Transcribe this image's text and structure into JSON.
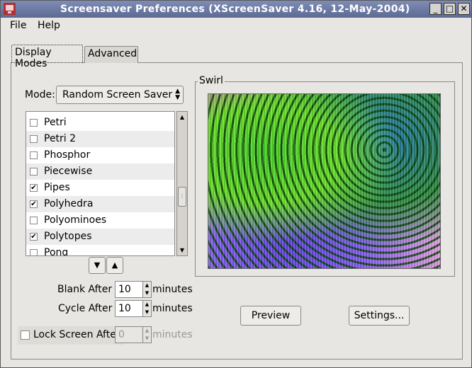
{
  "window": {
    "title": "Screensaver Preferences  (XScreenSaver 4.16, 12-May-2004)",
    "controls": {
      "minimize": "_",
      "maximize": "□",
      "close": "✕"
    }
  },
  "menubar": {
    "file": "File",
    "help": "Help"
  },
  "tabs": [
    {
      "label": "Display Modes",
      "active": true
    },
    {
      "label": "Advanced",
      "active": false
    }
  ],
  "mode": {
    "label": "Mode:",
    "value": "Random Screen Saver"
  },
  "savers": [
    {
      "label": "Petri",
      "checked": false
    },
    {
      "label": "Petri 2",
      "checked": false
    },
    {
      "label": "Phosphor",
      "checked": false
    },
    {
      "label": "Piecewise",
      "checked": false
    },
    {
      "label": "Pipes",
      "checked": true
    },
    {
      "label": "Polyhedra",
      "checked": true
    },
    {
      "label": "Polyominoes",
      "checked": false
    },
    {
      "label": "Polytopes",
      "checked": true
    },
    {
      "label": "Pong",
      "checked": false
    }
  ],
  "preview": {
    "frame_label": "Swirl",
    "preview_button": "Preview",
    "settings_button": "Settings..."
  },
  "timing": {
    "blank_after": {
      "label": "Blank After",
      "value": "10",
      "units": "minutes"
    },
    "cycle_after": {
      "label": "Cycle After",
      "value": "10",
      "units": "minutes"
    },
    "lock_after": {
      "label": "Lock Screen After",
      "value": "0",
      "units": "minutes",
      "checked": false,
      "enabled": false
    }
  },
  "icons": {
    "checkmark": "✔",
    "arrow_down": "▼",
    "arrow_up": "▲",
    "grip": "⋮"
  }
}
